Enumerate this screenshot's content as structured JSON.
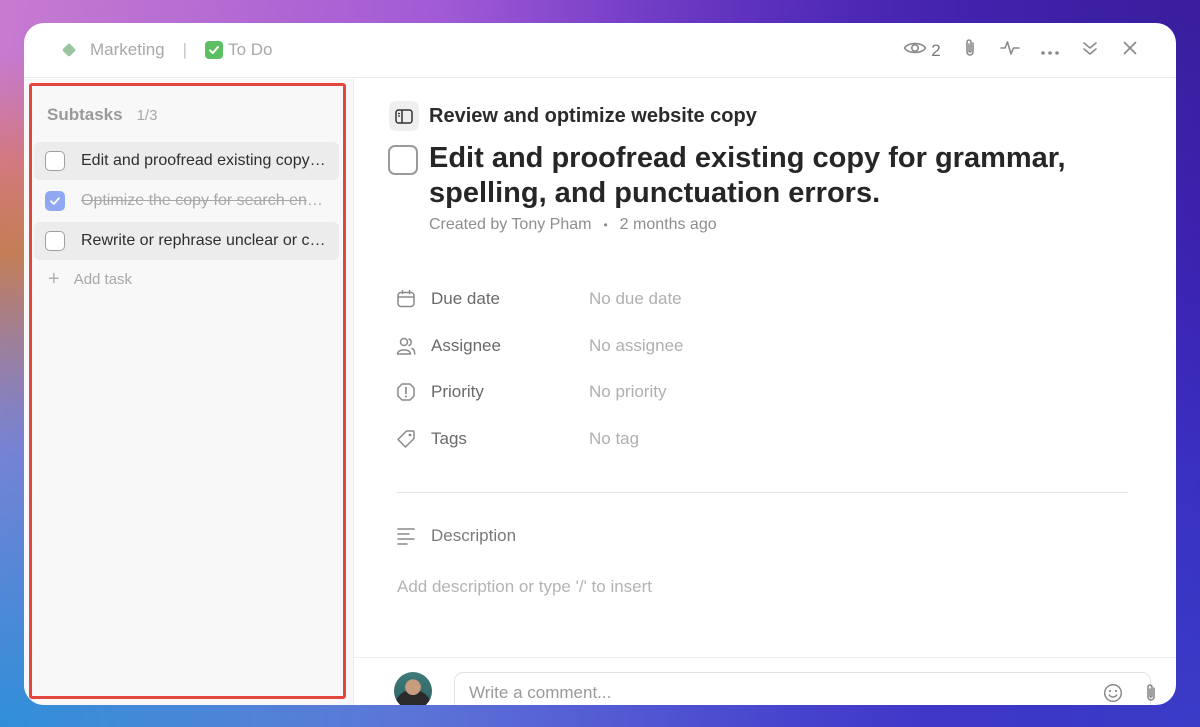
{
  "header": {
    "space": "Marketing",
    "separator": "|",
    "status": "To Do",
    "watchers_count": "2",
    "icons": [
      "eye-icon",
      "paperclip-icon",
      "activity-icon",
      "more-icon",
      "collapse-icon",
      "close-icon"
    ]
  },
  "sidebar": {
    "title": "Subtasks",
    "count": "1/3",
    "items": [
      {
        "label": "Edit and proofread existing copy for grammar, spelling, and punctuation errors.",
        "done": false,
        "selected": true
      },
      {
        "label": "Optimize the copy for search engines",
        "done": true,
        "selected": false
      },
      {
        "label": "Rewrite or rephrase unclear or confusing sentences",
        "done": false,
        "selected": false
      }
    ],
    "add_label": "Add task"
  },
  "task": {
    "parent": "Review and optimize website copy",
    "title": "Edit and proofread existing copy for grammar, spelling, and punctuation errors.",
    "created_by": "Created by Tony Pham",
    "created_when": "2 months ago",
    "fields": [
      {
        "label": "Due date",
        "value": "No due date",
        "icon": "calendar-icon"
      },
      {
        "label": "Assignee",
        "value": "No assignee",
        "icon": "users-icon"
      },
      {
        "label": "Priority",
        "value": "No priority",
        "icon": "priority-icon"
      },
      {
        "label": "Tags",
        "value": "No tag",
        "icon": "tag-icon"
      }
    ],
    "description_label": "Description",
    "description_placeholder": "Add description or type '/' to insert"
  },
  "comment": {
    "placeholder": "Write a comment..."
  },
  "colors": {
    "highlight": "#e2463f",
    "checked": "#8fa8f0",
    "status_green": "#5cc062"
  }
}
